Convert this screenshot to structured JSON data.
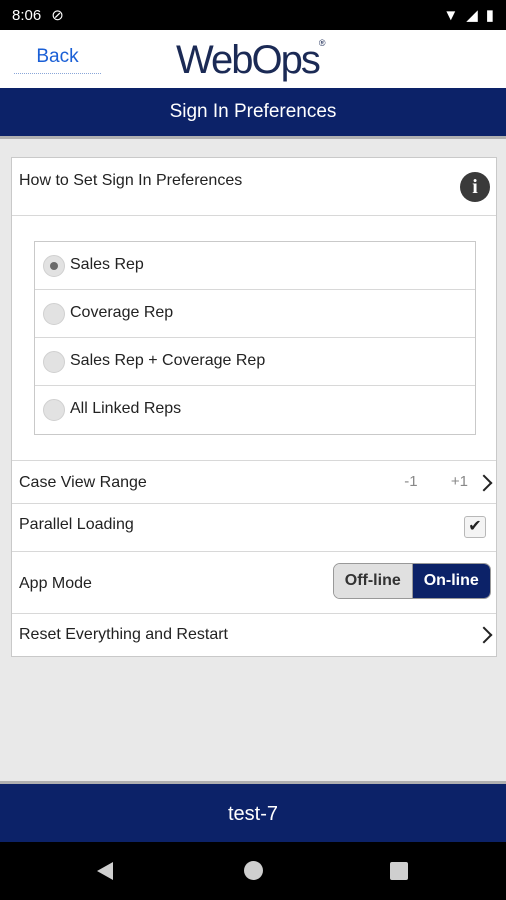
{
  "status_bar": {
    "time": "8:06"
  },
  "header": {
    "back_label": "Back",
    "logo_text": "WebOps"
  },
  "title_bar": {
    "title": "Sign In Preferences"
  },
  "settings": {
    "how_to_label": "How to Set Sign In Preferences",
    "rep_options": [
      {
        "label": "Sales Rep",
        "selected": true
      },
      {
        "label": "Coverage Rep",
        "selected": false
      },
      {
        "label": "Sales Rep + Coverage Rep",
        "selected": false
      },
      {
        "label": "All Linked Reps",
        "selected": false
      }
    ],
    "case_view_range": {
      "label": "Case View Range",
      "min": "-1",
      "max": "+1"
    },
    "parallel_loading": {
      "label": "Parallel Loading",
      "checked": true,
      "check_glyph": "✔"
    },
    "app_mode": {
      "label": "App Mode",
      "off_label": "Off-line",
      "on_label": "On-line",
      "selected": "On-line"
    },
    "reset_label": "Reset Everything and Restart"
  },
  "footer": {
    "user": "test-7"
  },
  "colors": {
    "primary": "#0c2268",
    "link": "#1a5fd6"
  }
}
